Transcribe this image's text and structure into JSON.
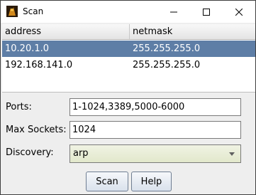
{
  "window": {
    "title": "Scan",
    "icon": "app-icon",
    "controls": [
      "minimize-icon",
      "maximize-icon",
      "close-icon"
    ]
  },
  "table": {
    "columns": [
      "address",
      "netmask"
    ],
    "rows": [
      {
        "address": "10.20.1.0",
        "netmask": "255.255.255.0",
        "selected": true
      },
      {
        "address": "192.168.141.0",
        "netmask": "255.255.255.0",
        "selected": false
      }
    ],
    "selection_color": "#5e7ea6"
  },
  "form": {
    "ports_label": "Ports:",
    "ports_value": "1-1024,3389,5000-6000",
    "sockets_label": "Max Sockets:",
    "sockets_value": "1024",
    "discovery_label": "Discovery:",
    "discovery_value": "arp"
  },
  "buttons": {
    "scan_label": "Scan",
    "help_label": "Help"
  }
}
